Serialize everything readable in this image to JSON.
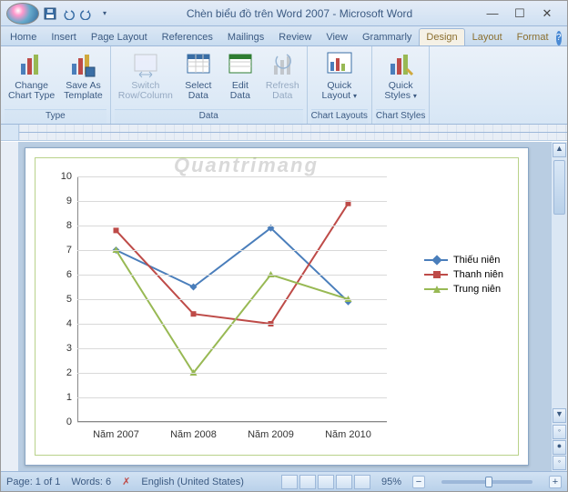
{
  "title": "Chèn biểu đồ trên Word 2007 - Microsoft Word",
  "tabs": [
    "Home",
    "Insert",
    "Page Layout",
    "References",
    "Mailings",
    "Review",
    "View",
    "Grammarly",
    "Design",
    "Layout",
    "Format"
  ],
  "active_tab": "Design",
  "ribbon": {
    "type": {
      "label": "Type",
      "change_chart": "Change\nChart Type",
      "save_template": "Save As\nTemplate"
    },
    "data": {
      "label": "Data",
      "switch": "Switch\nRow/Column",
      "select": "Select\nData",
      "edit": "Edit\nData",
      "refresh": "Refresh\nData"
    },
    "layouts": {
      "label": "Chart Layouts",
      "quick_layout": "Quick\nLayout"
    },
    "styles": {
      "label": "Chart Styles",
      "quick_styles": "Quick\nStyles"
    }
  },
  "status": {
    "page": "Page: 1 of 1",
    "words": "Words: 6",
    "language": "English (United States)",
    "zoom": "95%"
  },
  "watermark": "Quantrimang",
  "chart_data": {
    "type": "line",
    "categories": [
      "Năm 2007",
      "Năm 2008",
      "Năm 2009",
      "Năm 2010"
    ],
    "series": [
      {
        "name": "Thiếu niên",
        "color": "#4a7ebb",
        "values": [
          7.0,
          5.5,
          7.9,
          4.9
        ]
      },
      {
        "name": "Thanh niên",
        "color": "#be4b48",
        "values": [
          7.8,
          4.4,
          4.0,
          8.9
        ]
      },
      {
        "name": "Trung niên",
        "color": "#98b954",
        "values": [
          7.0,
          2.0,
          6.0,
          5.0
        ]
      }
    ],
    "ylim": [
      0,
      10
    ],
    "yticks": [
      0,
      1,
      2,
      3,
      4,
      5,
      6,
      7,
      8,
      9,
      10
    ],
    "xlabel": "",
    "ylabel": "",
    "title": ""
  }
}
